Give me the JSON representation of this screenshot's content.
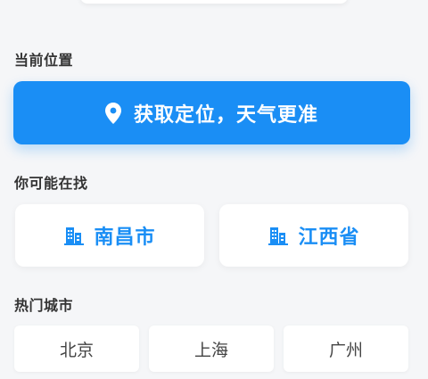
{
  "sections": {
    "current_location_title": "当前位置",
    "suggest_title": "你可能在找",
    "hot_cities_title": "热门城市"
  },
  "locate_button": {
    "label": "获取定位，天气更准",
    "icon": "map-pin-icon"
  },
  "suggestions": [
    {
      "label": "南昌市",
      "icon": "building-icon"
    },
    {
      "label": "江西省",
      "icon": "building-icon"
    }
  ],
  "hot_cities": [
    {
      "label": "北京"
    },
    {
      "label": "上海"
    },
    {
      "label": "广州"
    }
  ],
  "colors": {
    "accent": "#1a8ef5",
    "background": "#f5f6f8",
    "card": "#ffffff"
  }
}
